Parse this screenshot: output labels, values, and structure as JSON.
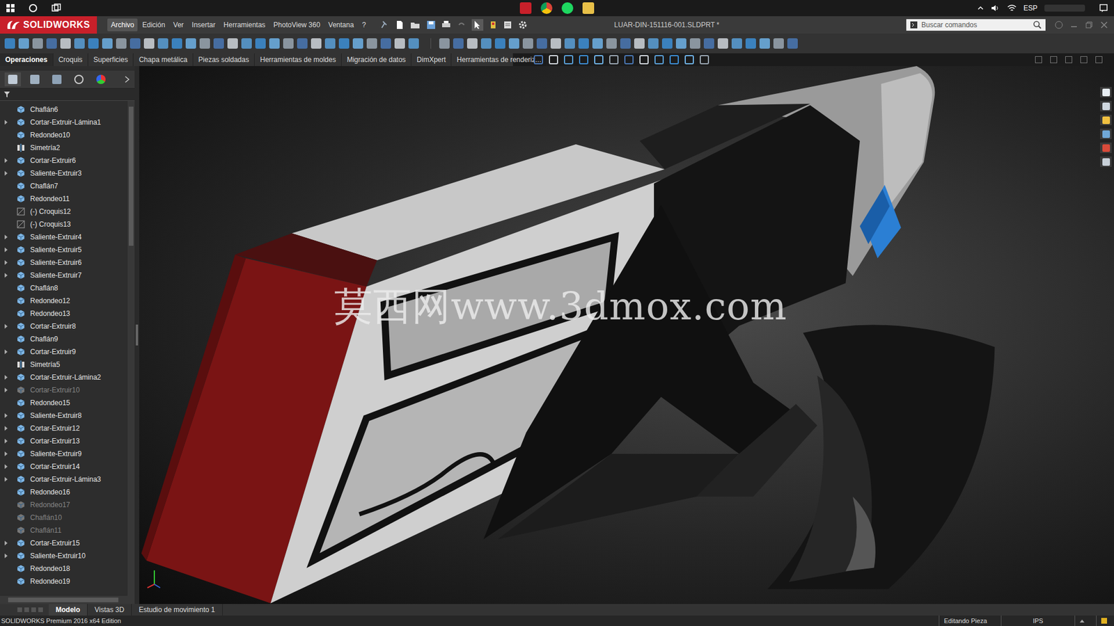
{
  "taskbar": {
    "language": "ESP"
  },
  "app": {
    "logo": "SOLIDWORKS",
    "menu": [
      {
        "label": "Archivo",
        "selected": true
      },
      {
        "label": "Edición",
        "selected": false
      },
      {
        "label": "Ver",
        "selected": false
      },
      {
        "label": "Insertar",
        "selected": false
      },
      {
        "label": "Herramientas",
        "selected": false
      },
      {
        "label": "PhotoView 360",
        "selected": false
      },
      {
        "label": "Ventana",
        "selected": false
      },
      {
        "label": "?",
        "selected": false
      }
    ],
    "document_title": "LUAR-DIN-151116-001.SLDPRT *",
    "search": {
      "placeholder": "Buscar comandos"
    }
  },
  "command_tabs": [
    {
      "label": "Operaciones",
      "selected": true
    },
    {
      "label": "Croquis",
      "selected": false
    },
    {
      "label": "Superficies",
      "selected": false
    },
    {
      "label": "Chapa metálica",
      "selected": false
    },
    {
      "label": "Piezas soldadas",
      "selected": false
    },
    {
      "label": "Herramientas de moldes",
      "selected": false
    },
    {
      "label": "Migración de datos",
      "selected": false
    },
    {
      "label": "DimXpert",
      "selected": false
    },
    {
      "label": "Herramientas de renderiz...",
      "selected": false
    }
  ],
  "feature_tree": {
    "items": [
      {
        "label": "Chaflán6",
        "kind": "feature",
        "expandable": false,
        "suppressed": false
      },
      {
        "label": "Cortar-Extruir-Lámina1",
        "kind": "feature",
        "expandable": true,
        "suppressed": false
      },
      {
        "label": "Redondeo10",
        "kind": "feature",
        "expandable": false,
        "suppressed": false
      },
      {
        "label": "Simetría2",
        "kind": "mirror",
        "expandable": false,
        "suppressed": false
      },
      {
        "label": "Cortar-Extruir6",
        "kind": "feature",
        "expandable": true,
        "suppressed": false
      },
      {
        "label": "Saliente-Extruir3",
        "kind": "feature",
        "expandable": true,
        "suppressed": false
      },
      {
        "label": "Chaflán7",
        "kind": "feature",
        "expandable": false,
        "suppressed": false
      },
      {
        "label": "Redondeo11",
        "kind": "feature",
        "expandable": false,
        "suppressed": false
      },
      {
        "label": "(-) Croquis12",
        "kind": "sketch",
        "expandable": false,
        "suppressed": false
      },
      {
        "label": "(-) Croquis13",
        "kind": "sketch",
        "expandable": false,
        "suppressed": false
      },
      {
        "label": "Saliente-Extruir4",
        "kind": "feature",
        "expandable": true,
        "suppressed": false
      },
      {
        "label": "Saliente-Extruir5",
        "kind": "feature",
        "expandable": true,
        "suppressed": false
      },
      {
        "label": "Saliente-Extruir6",
        "kind": "feature",
        "expandable": true,
        "suppressed": false
      },
      {
        "label": "Saliente-Extruir7",
        "kind": "feature",
        "expandable": true,
        "suppressed": false
      },
      {
        "label": "Chaflán8",
        "kind": "feature",
        "expandable": false,
        "suppressed": false
      },
      {
        "label": "Redondeo12",
        "kind": "feature",
        "expandable": false,
        "suppressed": false
      },
      {
        "label": "Redondeo13",
        "kind": "feature",
        "expandable": false,
        "suppressed": false
      },
      {
        "label": "Cortar-Extruir8",
        "kind": "feature",
        "expandable": true,
        "suppressed": false
      },
      {
        "label": "Chaflán9",
        "kind": "feature",
        "expandable": false,
        "suppressed": false
      },
      {
        "label": "Cortar-Extruir9",
        "kind": "feature",
        "expandable": true,
        "suppressed": false
      },
      {
        "label": "Simetría5",
        "kind": "mirror",
        "expandable": false,
        "suppressed": false
      },
      {
        "label": "Cortar-Extruir-Lámina2",
        "kind": "feature",
        "expandable": true,
        "suppressed": false
      },
      {
        "label": "Cortar-Extruir10",
        "kind": "feature",
        "expandable": true,
        "suppressed": true
      },
      {
        "label": "Redondeo15",
        "kind": "feature",
        "expandable": false,
        "suppressed": false
      },
      {
        "label": "Saliente-Extruir8",
        "kind": "feature",
        "expandable": true,
        "suppressed": false
      },
      {
        "label": "Cortar-Extruir12",
        "kind": "feature",
        "expandable": true,
        "suppressed": false
      },
      {
        "label": "Cortar-Extruir13",
        "kind": "feature",
        "expandable": true,
        "suppressed": false
      },
      {
        "label": "Saliente-Extruir9",
        "kind": "feature",
        "expandable": true,
        "suppressed": false
      },
      {
        "label": "Cortar-Extruir14",
        "kind": "feature",
        "expandable": true,
        "suppressed": false
      },
      {
        "label": "Cortar-Extruir-Lámina3",
        "kind": "feature",
        "expandable": true,
        "suppressed": false
      },
      {
        "label": "Redondeo16",
        "kind": "feature",
        "expandable": false,
        "suppressed": false
      },
      {
        "label": "Redondeo17",
        "kind": "feature",
        "expandable": false,
        "suppressed": true
      },
      {
        "label": "Chaflán10",
        "kind": "feature",
        "expandable": false,
        "suppressed": true
      },
      {
        "label": "Chaflán11",
        "kind": "feature",
        "expandable": false,
        "suppressed": true
      },
      {
        "label": "Cortar-Extruir15",
        "kind": "feature",
        "expandable": true,
        "suppressed": false
      },
      {
        "label": "Saliente-Extruir10",
        "kind": "feature",
        "expandable": true,
        "suppressed": false
      },
      {
        "label": "Redondeo18",
        "kind": "feature",
        "expandable": false,
        "suppressed": false
      },
      {
        "label": "Redondeo19",
        "kind": "feature",
        "expandable": false,
        "suppressed": false
      }
    ]
  },
  "viewport": {
    "watermark": "莫西网www.3dmox.com"
  },
  "bottom_tabs": [
    {
      "label": "Modelo",
      "selected": true
    },
    {
      "label": "Vistas 3D",
      "selected": false
    },
    {
      "label": "Estudio de movimiento 1",
      "selected": false
    }
  ],
  "status_bar": {
    "edition": "SOLIDWORKS Premium 2016 x64 Edition",
    "mode": "Editando Pieza",
    "units": "IPS"
  }
}
